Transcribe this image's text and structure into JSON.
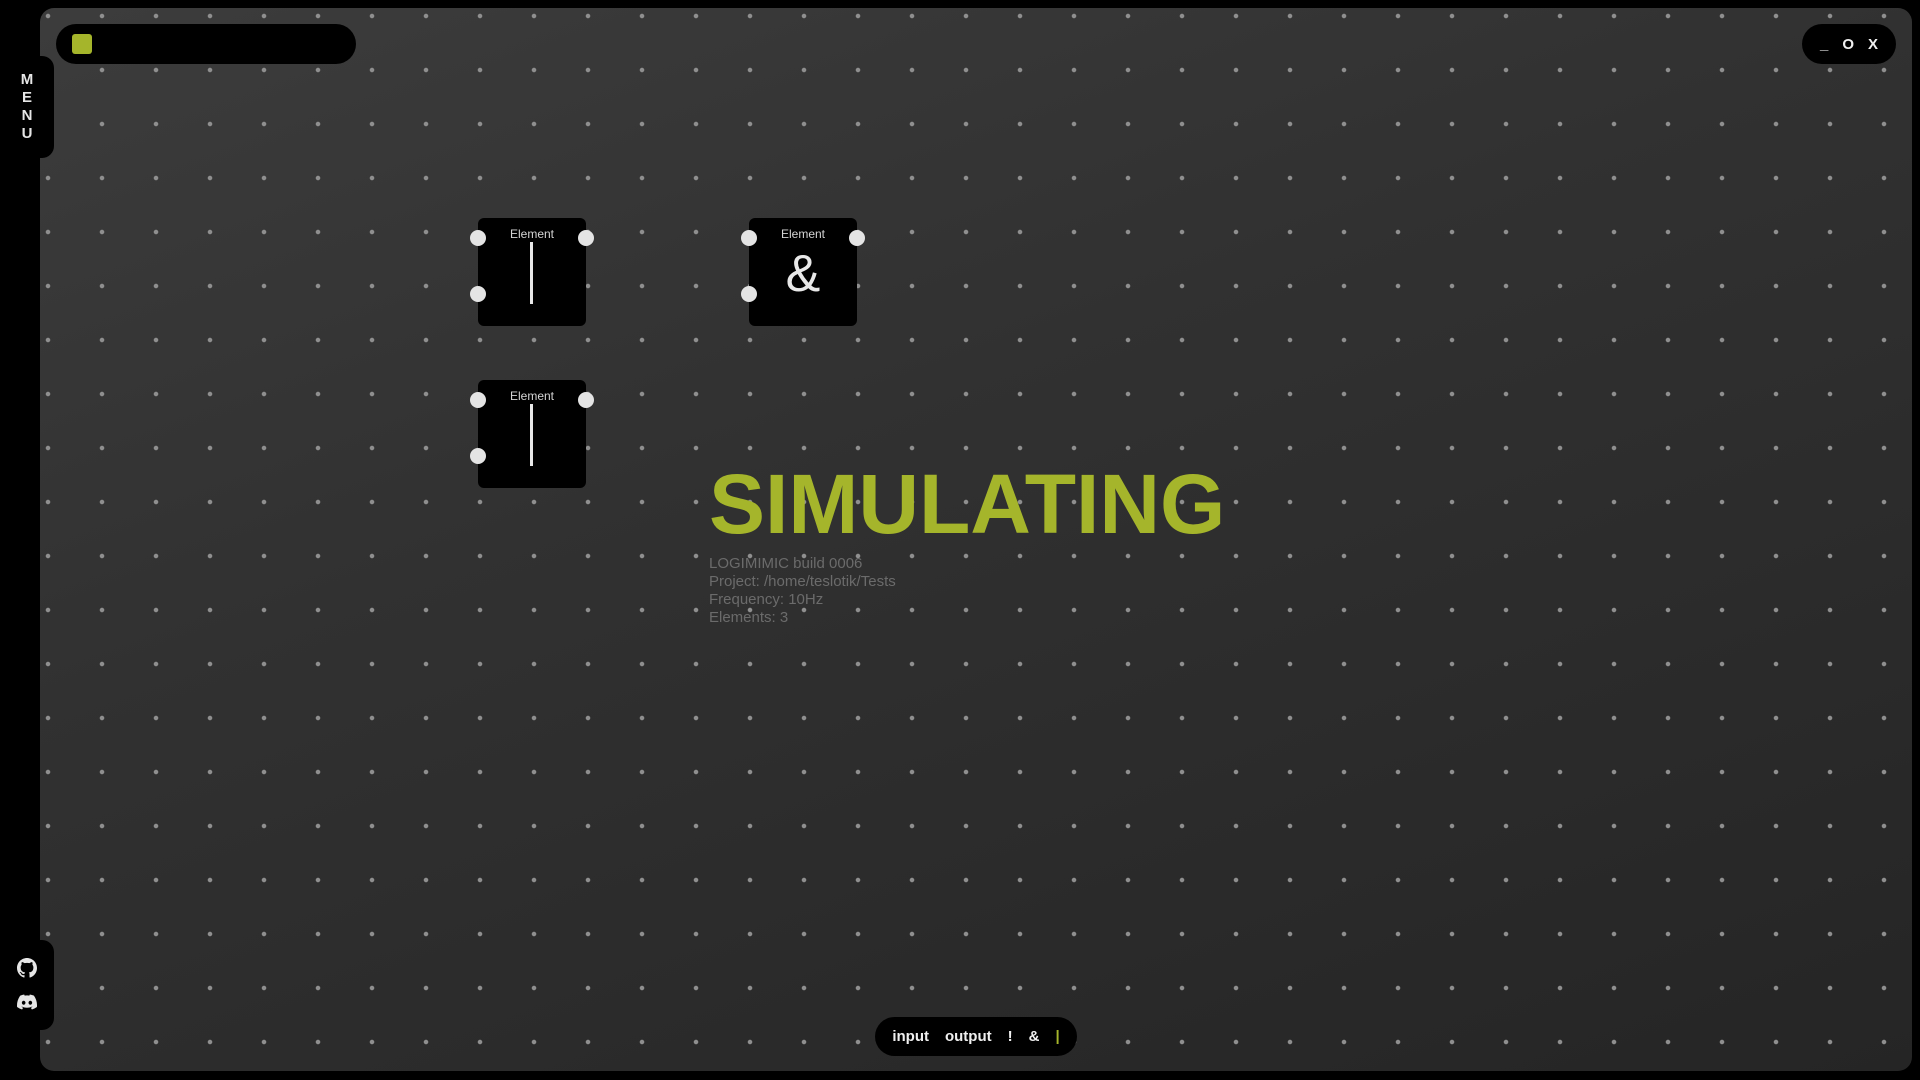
{
  "sidebar": {
    "menu_letters": [
      "M",
      "E",
      "N",
      "U"
    ],
    "social_icons": [
      "github-icon",
      "discord-icon"
    ]
  },
  "top_bar": {
    "status_color": "#a5b52b"
  },
  "window_controls": {
    "minimize": "_",
    "maximize": "O",
    "close": "X"
  },
  "elements": [
    {
      "title": "Element",
      "symbol": "|"
    },
    {
      "title": "Element",
      "symbol": "&"
    },
    {
      "title": "Element",
      "symbol": "|"
    }
  ],
  "status": {
    "title": "SIMULATING",
    "build": "LOGIMIMIC build 0006",
    "project": "Project: /home/teslotik/Tests",
    "frequency": "Frequency: 10Hz",
    "elements": "Elements: 3"
  },
  "toolbar": {
    "items": [
      "input",
      "output",
      "!",
      "&",
      "|"
    ],
    "active_item": "|"
  },
  "colors": {
    "accent": "#a5b52b",
    "background": "#333333",
    "panel": "#000000"
  }
}
